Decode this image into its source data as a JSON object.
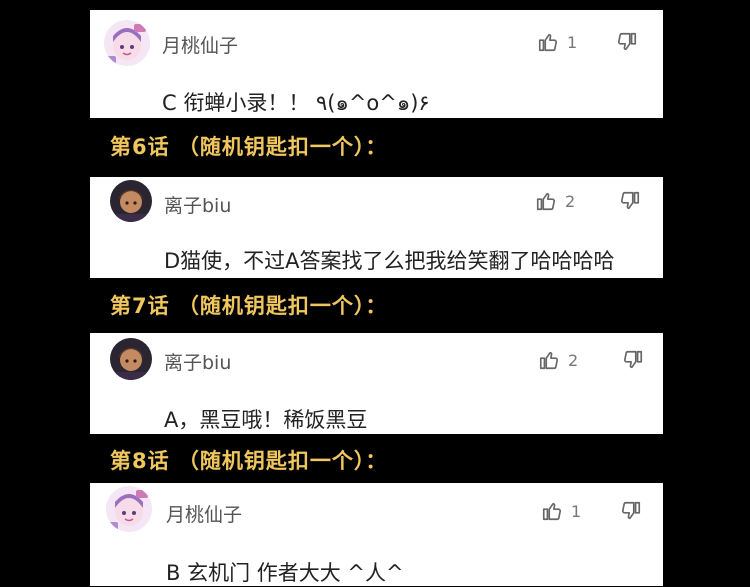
{
  "comments": [
    {
      "username": "月桃仙子",
      "likes": "1",
      "text": "C 衔蝉小录！！ ٩(๑^o^๑)۶",
      "avatar": "anime-girl-avatar"
    },
    {
      "username": "离子biu",
      "likes": "2",
      "text": "D猫使，不过A答案找了么把我给笑翻了哈哈哈哈",
      "avatar": "dark-portrait-avatar"
    },
    {
      "username": "离子biu",
      "likes": "2",
      "text": "A，黑豆哦！稀饭黑豆",
      "avatar": "dark-portrait-avatar"
    },
    {
      "username": "月桃仙子",
      "likes": "1",
      "text": "B 玄机门 作者大大 ^人^",
      "avatar": "anime-girl-avatar"
    }
  ],
  "headers": [
    "第6话 （随机钥匙扣一个）：",
    "第7话 （随机钥匙扣一个）：",
    "第8话 （随机钥匙扣一个）："
  ],
  "colors": {
    "header": "#f0c75e",
    "background": "#000000",
    "card": "#ffffff"
  }
}
